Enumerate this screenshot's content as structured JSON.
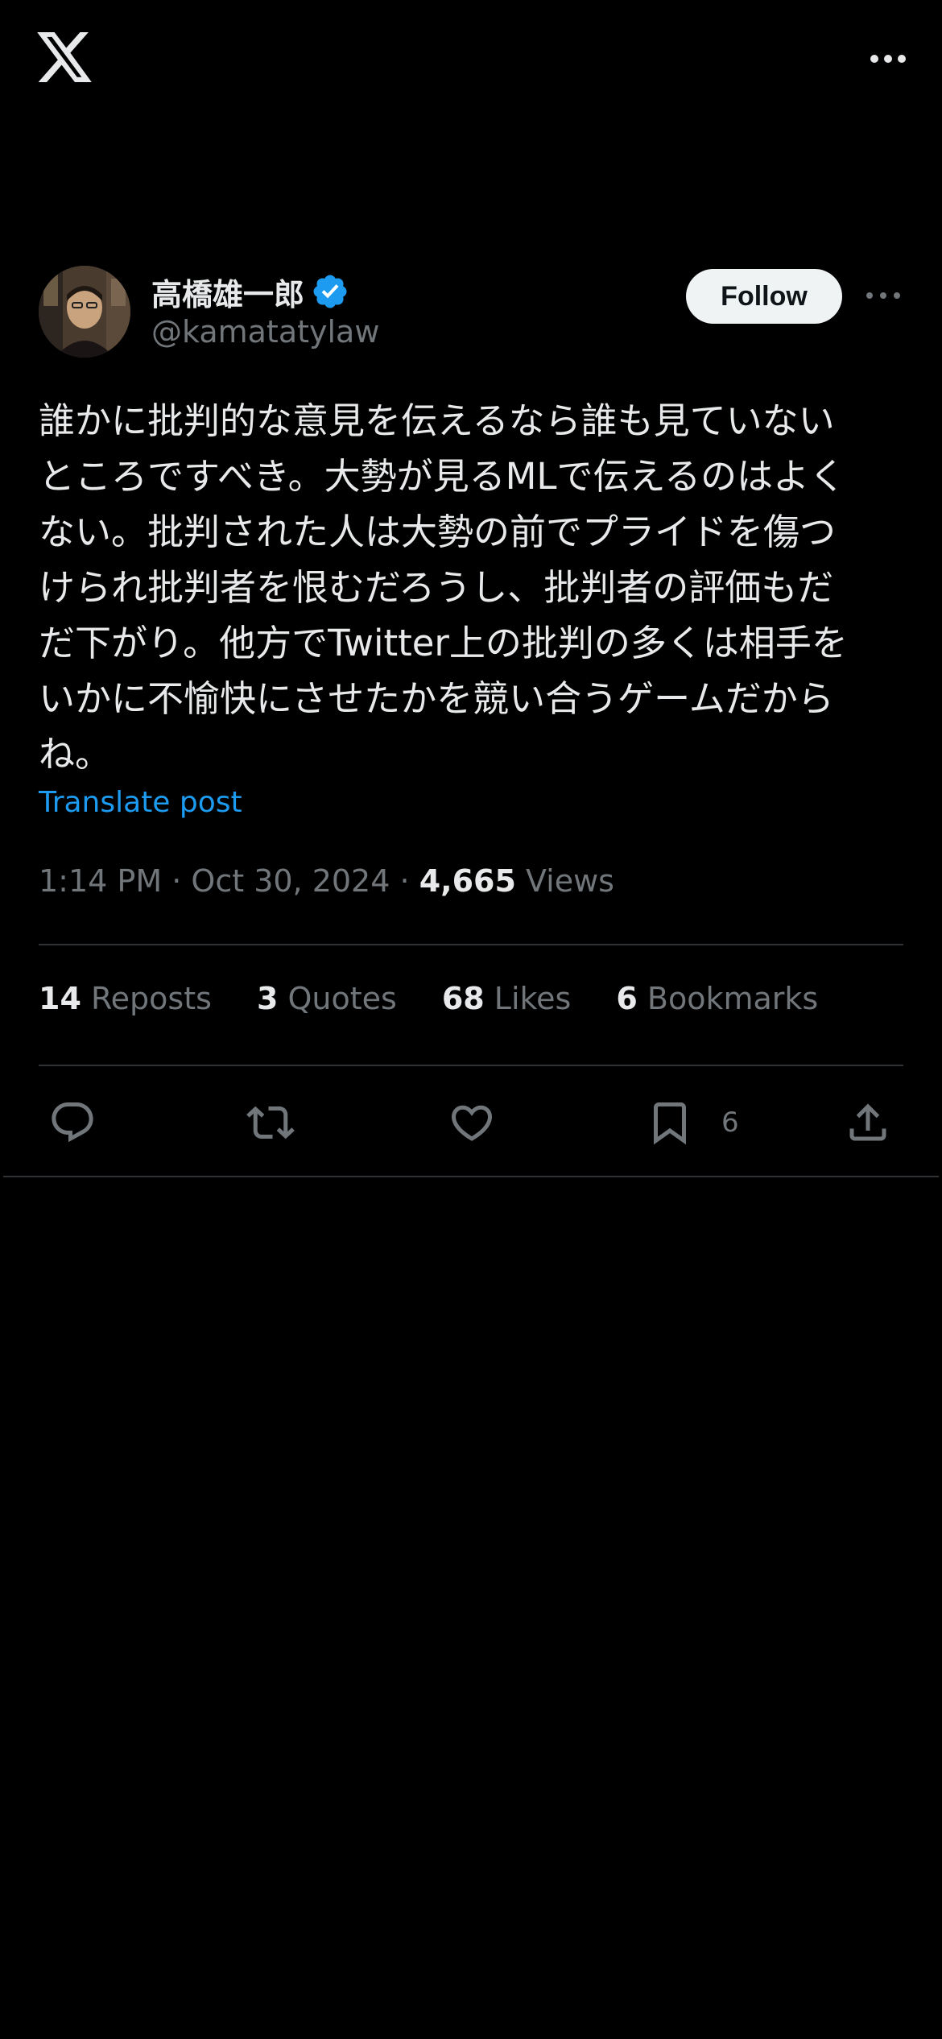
{
  "app": {
    "logo_icon": "x-logo-icon",
    "menu_icon": "more-horizontal-icon"
  },
  "author": {
    "display_name": "高橋雄一郎",
    "verified_icon": "verified-badge-icon",
    "handle": "@kamatatylaw",
    "follow_label": "Follow",
    "more_icon": "more-horizontal-icon"
  },
  "post": {
    "text": "誰かに批判的な意見を伝えるなら誰も見ていない\nところですべき。大勢が見るMLで伝えるのはよく\nない。批判された人は大勢の前でプライドを傷つ\nけられ批判者を恨むだろうし、批判者の評価もだ\nだ下がり。他方でTwitter上の批判の多くは相手を\nいかに不愉快にさせたかを競い合うゲームだから\nね。",
    "translate_label": "Translate post",
    "time": "1:14 PM",
    "date": "Oct 30, 2024",
    "separator": "·",
    "views_count": "4,665",
    "views_label": "Views"
  },
  "stats": {
    "reposts": {
      "count": "14",
      "label": "Reposts"
    },
    "quotes": {
      "count": "3",
      "label": "Quotes"
    },
    "likes": {
      "count": "68",
      "label": "Likes"
    },
    "bookmarks": {
      "count": "6",
      "label": "Bookmarks"
    }
  },
  "actions": {
    "reply_icon": "reply-icon",
    "repost_icon": "repost-icon",
    "like_icon": "heart-icon",
    "bookmark_icon": "bookmark-icon",
    "bookmark_count": "6",
    "share_icon": "share-icon"
  },
  "colors": {
    "background": "#000000",
    "text": "#e7e9ea",
    "muted": "#71767b",
    "accent": "#1d9bf0",
    "divider": "#2f3336",
    "follow_bg": "#eff3f4"
  }
}
